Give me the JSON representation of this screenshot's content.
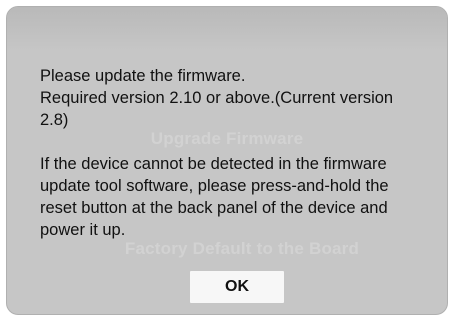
{
  "background": {
    "upgrade_label": "Upgrade Firmware",
    "factory_label": "Factory Default to the Board"
  },
  "dialog": {
    "line1": "Please update the firmware.",
    "line2": "Required version 2.10 or above.(Current version 2.8)",
    "line3": "If the device cannot be detected in the firmware update tool software, please press-and-hold the reset button at the back panel of the device and power it up.",
    "ok_label": "OK"
  },
  "colors": {
    "overlay": "#c6c6c6",
    "button": "#f7f7f7",
    "text": "#111111"
  }
}
